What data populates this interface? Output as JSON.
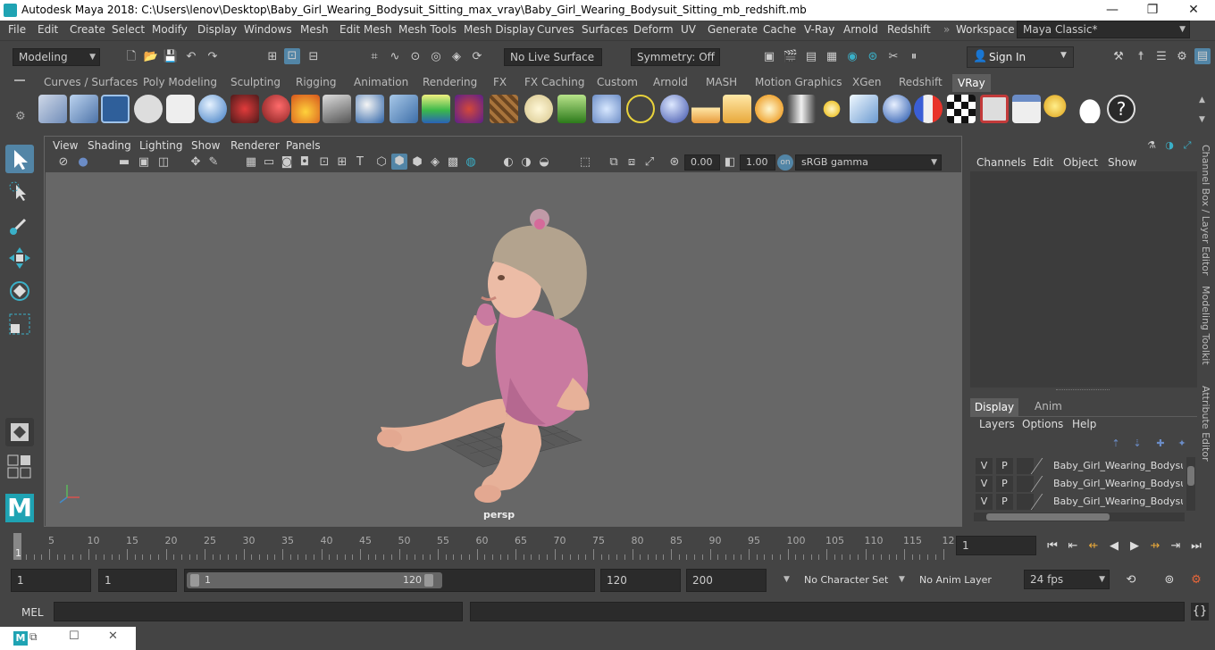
{
  "window": {
    "title": "Autodesk Maya 2018: C:\\Users\\lenov\\Desktop\\Baby_Girl_Wearing_Bodysuit_Sitting_max_vray\\Baby_Girl_Wearing_Bodysuit_Sitting_mb_redshift.mb",
    "minimize": "—",
    "maximize": "❐",
    "close": "✕"
  },
  "menubar": {
    "items": [
      "File",
      "Edit",
      "Create",
      "Select",
      "Modify",
      "Display",
      "Windows",
      "Mesh",
      "Edit Mesh",
      "Mesh Tools",
      "Mesh Display",
      "Curves",
      "Surfaces",
      "Deform",
      "UV",
      "Generate",
      "Cache",
      "V-Ray",
      "Arnold",
      "Redshift"
    ],
    "workspace_label": "Workspace :",
    "workspace_value": "Maya Classic*"
  },
  "statusline": {
    "mode": "Modeling",
    "live_surface": "No Live Surface",
    "symmetry": "Symmetry: Off",
    "sign_in": "Sign In"
  },
  "shelf": {
    "tabs": [
      "Curves / Surfaces",
      "Poly Modeling",
      "Sculpting",
      "Rigging",
      "Animation",
      "Rendering",
      "FX",
      "FX Caching",
      "Custom",
      "Arnold",
      "MASH",
      "Motion Graphics",
      "XGen",
      "Redshift",
      "VRay"
    ],
    "active_tab": "VRay"
  },
  "viewport": {
    "menus": [
      "View",
      "Shading",
      "Lighting",
      "Show",
      "Renderer",
      "Panels"
    ],
    "exposure": "0.00",
    "gamma": "1.00",
    "color_space": "sRGB gamma",
    "camera_label": "persp",
    "accent": "#5285a6"
  },
  "channelbox": {
    "menus": [
      "Channels",
      "Edit",
      "Object",
      "Show"
    ]
  },
  "layers": {
    "tabs": [
      "Display",
      "Anim"
    ],
    "active_tab": "Display",
    "menus": [
      "Layers",
      "Options",
      "Help"
    ],
    "rows": [
      {
        "v": "V",
        "p": "P",
        "name": "Baby_Girl_Wearing_Bodysuit"
      },
      {
        "v": "V",
        "p": "P",
        "name": "Baby_Girl_Wearing_Bodysuit"
      },
      {
        "v": "V",
        "p": "P",
        "name": "Baby_Girl_Wearing_Bodysuit"
      }
    ]
  },
  "sidebar_tabs": [
    "Channel Box / Layer Editor",
    "Modeling Toolkit",
    "Attribute Editor"
  ],
  "timeslider": {
    "ticks": [
      "5",
      "10",
      "15",
      "20",
      "25",
      "30",
      "35",
      "40",
      "45",
      "50",
      "55",
      "60",
      "65",
      "70",
      "75",
      "80",
      "85",
      "90",
      "95",
      "100",
      "105",
      "110",
      "115",
      "12"
    ],
    "first": "1",
    "current_frame": "1"
  },
  "range": {
    "start": "1",
    "playback_start": "1",
    "slider_start": "1",
    "slider_end": "120",
    "playback_end": "120",
    "end": "200",
    "character_set": "No Character Set",
    "anim_layer": "No Anim Layer",
    "fps": "24 fps"
  },
  "cmdline": {
    "label": "MEL"
  }
}
